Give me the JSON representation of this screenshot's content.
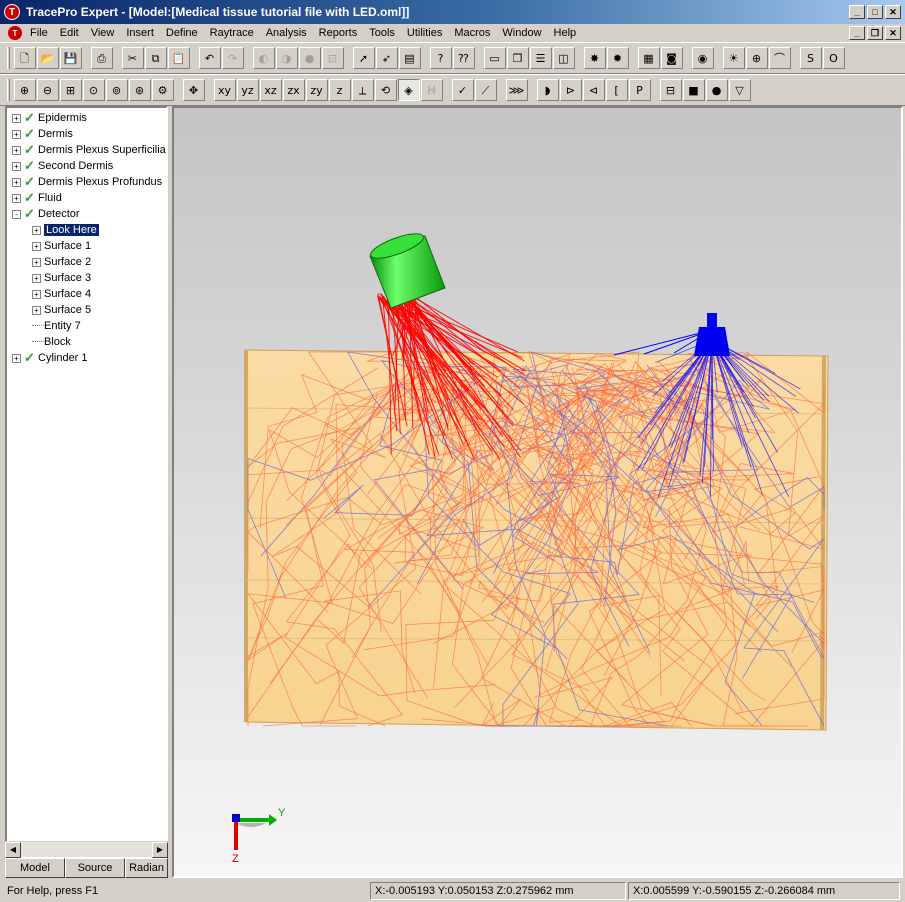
{
  "window": {
    "title": "TracePro Expert - [Model:[Medical tissue tutorial file with LED.oml]]",
    "app_icon": "tracepro-logo-icon"
  },
  "menu": [
    "File",
    "Edit",
    "View",
    "Insert",
    "Define",
    "Raytrace",
    "Analysis",
    "Reports",
    "Tools",
    "Utilities",
    "Macros",
    "Window",
    "Help"
  ],
  "toolbar1": [
    {
      "name": "new-file-icon",
      "glyph": "🗋"
    },
    {
      "name": "open-folder-icon",
      "glyph": "📂"
    },
    {
      "name": "save-icon",
      "glyph": "💾"
    },
    {
      "name": "print-icon",
      "glyph": "⎙"
    },
    {
      "name": "cut-icon",
      "glyph": "✂"
    },
    {
      "name": "copy-icon",
      "glyph": "⧉"
    },
    {
      "name": "paste-icon",
      "glyph": "📋"
    },
    {
      "name": "undo-icon",
      "glyph": "↶"
    },
    {
      "name": "redo-icon",
      "glyph": "↷",
      "disabled": true
    },
    {
      "name": "boolean-union-icon",
      "glyph": "◐",
      "disabled": true
    },
    {
      "name": "boolean-intersect-icon",
      "glyph": "◑",
      "disabled": true
    },
    {
      "name": "boolean-subtract-icon",
      "glyph": "●",
      "disabled": true
    },
    {
      "name": "move-object-icon",
      "glyph": "⊡",
      "disabled": true
    },
    {
      "name": "select-arrow-icon",
      "glyph": "➚"
    },
    {
      "name": "select-object-icon",
      "glyph": "➶"
    },
    {
      "name": "notes-icon",
      "glyph": "▤"
    },
    {
      "name": "help-icon",
      "glyph": "?"
    },
    {
      "name": "context-help-icon",
      "glyph": "⁇"
    },
    {
      "name": "window-new-icon",
      "glyph": "▭"
    },
    {
      "name": "window-cascade-icon",
      "glyph": "❐"
    },
    {
      "name": "window-tile-horizontal-icon",
      "glyph": "☰"
    },
    {
      "name": "window-tile-vertical-icon",
      "glyph": "◫"
    },
    {
      "name": "raytrace-icon",
      "glyph": "✸"
    },
    {
      "name": "reverse-raytrace-icon",
      "glyph": "✹"
    },
    {
      "name": "irradiance-map-icon",
      "glyph": "▦"
    },
    {
      "name": "candela-plot-icon",
      "glyph": "◙"
    },
    {
      "name": "analysis-icon",
      "glyph": "◉"
    },
    {
      "name": "source-icon",
      "glyph": "☀"
    },
    {
      "name": "target-icon",
      "glyph": "⊕"
    },
    {
      "name": "chart-icon",
      "glyph": "⌒"
    },
    {
      "name": "srt-icon",
      "glyph": "S"
    },
    {
      "name": "opl-icon",
      "glyph": "O"
    }
  ],
  "toolbar2": [
    {
      "name": "zoom-in-icon",
      "glyph": "⊕"
    },
    {
      "name": "zoom-out-icon",
      "glyph": "⊖"
    },
    {
      "name": "zoom-window-icon",
      "glyph": "⊞"
    },
    {
      "name": "zoom-fit-icon",
      "glyph": "⊙"
    },
    {
      "name": "zoom-selection-icon",
      "glyph": "⊚"
    },
    {
      "name": "zoom-previous-icon",
      "glyph": "⊛"
    },
    {
      "name": "zoom-options-icon",
      "glyph": "⚙"
    },
    {
      "name": "pan-icon",
      "glyph": "✥"
    },
    {
      "name": "view-xy-icon",
      "glyph": "xy"
    },
    {
      "name": "view-yz-icon",
      "glyph": "yz"
    },
    {
      "name": "view-xz-icon",
      "glyph": "xz"
    },
    {
      "name": "view-zx-icon",
      "glyph": "zx"
    },
    {
      "name": "view-zy-icon",
      "glyph": "zy"
    },
    {
      "name": "view-zyx-icon",
      "glyph": "z"
    },
    {
      "name": "view-iso-icon",
      "glyph": "⟂"
    },
    {
      "name": "view-rotate-icon",
      "glyph": "⟲"
    },
    {
      "name": "render-mode-icon",
      "glyph": "◈",
      "active": true
    },
    {
      "name": "hidden-line-icon",
      "glyph": "H",
      "disabled": true
    },
    {
      "name": "check-icon",
      "glyph": "✓"
    },
    {
      "name": "ruler-icon",
      "glyph": "⟋"
    },
    {
      "name": "ray-display-icon",
      "glyph": "⋙"
    },
    {
      "name": "lens-icon",
      "glyph": "◗"
    },
    {
      "name": "reflector-icon",
      "glyph": "⊳"
    },
    {
      "name": "tir-icon",
      "glyph": "⊲"
    },
    {
      "name": "bracket-icon",
      "glyph": "["
    },
    {
      "name": "prism-p-icon",
      "glyph": "P"
    },
    {
      "name": "tube-icon",
      "glyph": "⊟"
    },
    {
      "name": "block-icon",
      "glyph": "■"
    },
    {
      "name": "sphere-icon",
      "glyph": "●"
    },
    {
      "name": "cone-icon",
      "glyph": "▽"
    }
  ],
  "tree": {
    "items": [
      {
        "label": "Epidermis",
        "level": 0,
        "toggle": "+",
        "check": true
      },
      {
        "label": "Dermis",
        "level": 0,
        "toggle": "+",
        "check": true
      },
      {
        "label": "Dermis Plexus Superficilias",
        "level": 0,
        "toggle": "+",
        "check": true
      },
      {
        "label": "Second Dermis",
        "level": 0,
        "toggle": "+",
        "check": true
      },
      {
        "label": "Dermis Plexus Profundus",
        "level": 0,
        "toggle": "+",
        "check": true
      },
      {
        "label": "Fluid",
        "level": 0,
        "toggle": "+",
        "check": true
      },
      {
        "label": "Detector",
        "level": 0,
        "toggle": "-",
        "check": true
      },
      {
        "label": "Look Here",
        "level": 1,
        "toggle": "+",
        "selected": true
      },
      {
        "label": "Surface 1",
        "level": 1,
        "toggle": "+"
      },
      {
        "label": "Surface 2",
        "level": 1,
        "toggle": "+"
      },
      {
        "label": "Surface 3",
        "level": 1,
        "toggle": "+"
      },
      {
        "label": "Surface 4",
        "level": 1,
        "toggle": "+"
      },
      {
        "label": "Surface 5",
        "level": 1,
        "toggle": "+"
      },
      {
        "label": "Entity 7",
        "level": 1,
        "toggle": ""
      },
      {
        "label": "Block",
        "level": 1,
        "toggle": ""
      },
      {
        "label": "Cylinder 1",
        "level": 0,
        "toggle": "+",
        "check": true
      }
    ]
  },
  "tabs": [
    "Model",
    "Source",
    "Radian"
  ],
  "viewport": {
    "colors": {
      "tissue": "#fad89a",
      "tissue_edge": "#d8b070",
      "led_body": "#22cc22",
      "source_rays": "#ff0000",
      "scatter_rays": "#ff7040",
      "detector_rays": "#0000ff"
    },
    "axis": {
      "y_label": "Y",
      "z_label": "Z"
    }
  },
  "status": {
    "help": "For Help, press F1",
    "coord1": "X:-0.005193 Y:0.050153 Z:0.275962 mm",
    "coord2": "X:0.005599 Y:-0.590155 Z:-0.266084 mm"
  }
}
